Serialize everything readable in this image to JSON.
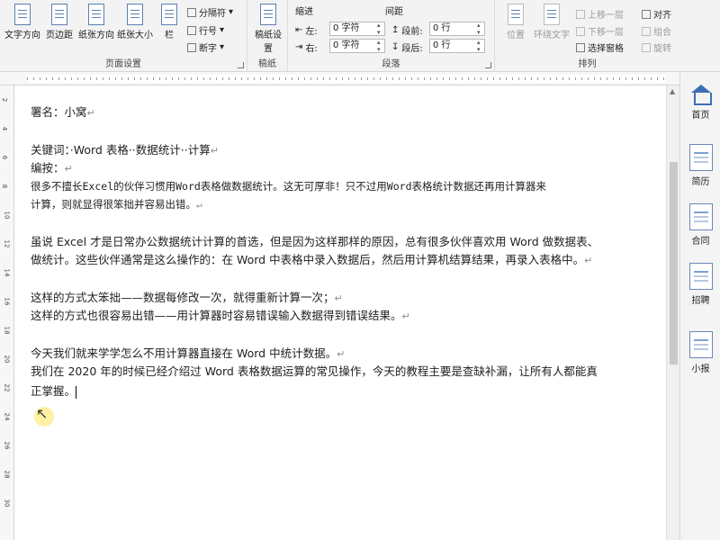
{
  "ribbon": {
    "page_setup": {
      "text_direction": "文字方向",
      "margins": "页边距",
      "orientation": "纸张方向",
      "size": "纸张大小",
      "columns": "栏",
      "breaks": "分隔符",
      "line_numbers": "行号",
      "hyphenation": "断字",
      "title": "页面设置"
    },
    "manuscript": {
      "button": "稿纸设置",
      "title": "稿纸"
    },
    "paragraph": {
      "indent_label": "缩进",
      "spacing_label": "间距",
      "left_label": "左:",
      "right_label": "右:",
      "before_label": "段前:",
      "after_label": "段后:",
      "left_value": "0 字符",
      "right_value": "0 字符",
      "before_value": "0 行",
      "after_value": "0 行",
      "title": "段落"
    },
    "arrange": {
      "position": "位置",
      "wrap_text": "环绕文字",
      "bring_forward": "上移一层",
      "send_backward": "下移一层",
      "selection_pane": "选择窗格",
      "align": "对齐",
      "group": "组合",
      "rotate": "旋转",
      "title": "排列"
    }
  },
  "document": {
    "lines": [
      "署名：小窝",
      "关键词：·Word 表格··数据统计··计算",
      "编按：",
      "很多不擅长Excel的伙伴习惯用Word表格做数据统计。这无可厚非！只不过用Word表格统计数据还再用计算器来",
      "计算，则就显得很笨拙并容易出错。",
      "虽说 Excel 才是日常办公数据统计计算的首选，但是因为这样那样的原因，总有很多伙伴喜欢用 Word 做数据表、",
      "做统计。这些伙伴通常是这么操作的：在 Word 中表格中录入数据后，然后用计算机结算结果，再录入表格中。",
      "这样的方式太笨拙——数据每修改一次，就得重新计算一次；",
      "这样的方式也很容易出错——用计算器时容易错误输入数据得到错误结果。",
      "今天我们就来学学怎么不用计算器直接在 Word 中统计数据。",
      "我们在 2020 年的时候已经介绍过 Word 表格数据运算的常见操作，今天的教程主要是查缺补漏，让所有人都能真",
      "正掌握。"
    ],
    "para_mark": "↵"
  },
  "side_panel": {
    "items": [
      "首页",
      "简历",
      "合同",
      "招聘",
      "小报"
    ]
  },
  "vruler_numbers": [
    "2",
    "4",
    "6",
    "8",
    "10",
    "12",
    "14",
    "16",
    "18",
    "20",
    "22",
    "24",
    "26",
    "28",
    "30"
  ]
}
